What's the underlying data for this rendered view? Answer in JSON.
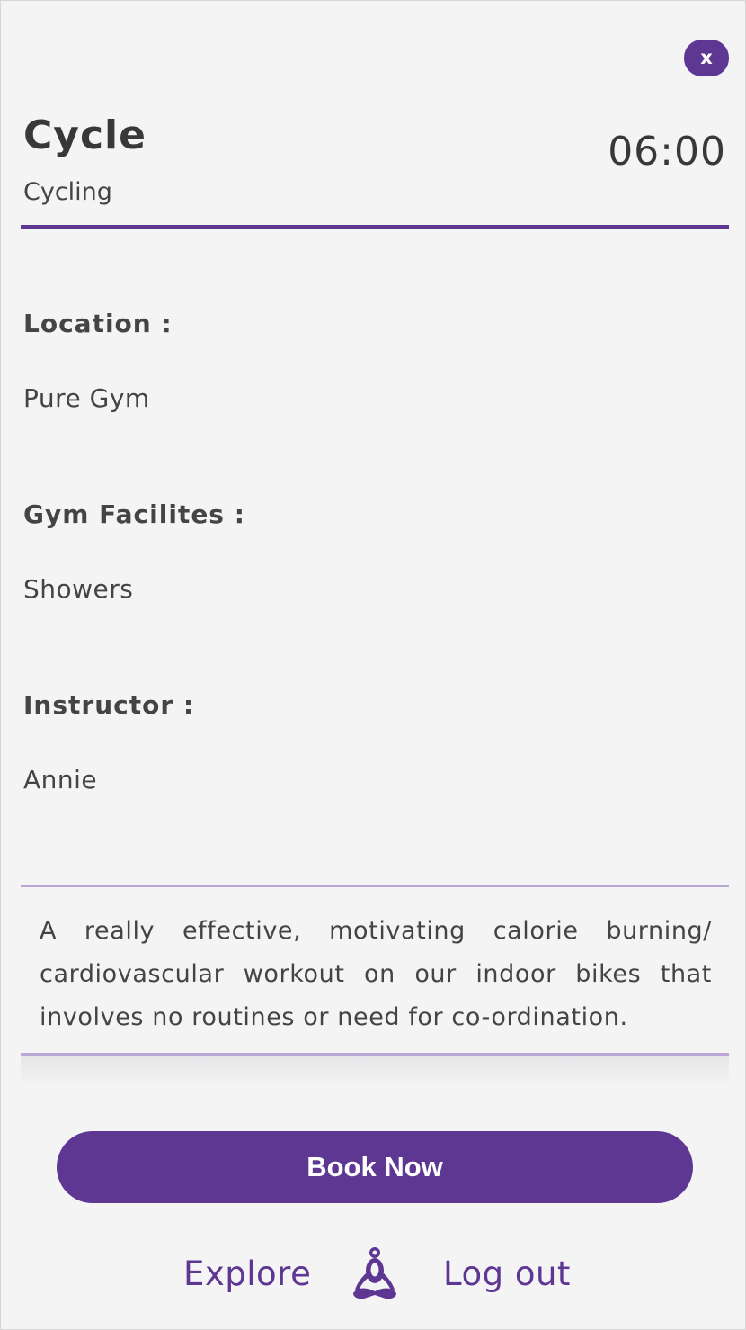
{
  "dialog": {
    "close_label": "x",
    "title": "Cycle",
    "category": "Cycling",
    "time": "06:00"
  },
  "details": {
    "location_label": "Location :",
    "location_value": "Pure Gym",
    "facilities_label": "Gym Facilites :",
    "facilities_value": "Showers",
    "instructor_label": "Instructor :",
    "instructor_value": "Annie"
  },
  "description": "A really effective, motivating calorie burning/ cardiovascular workout on our indoor bikes that involves no routines or need for co-ordination.",
  "actions": {
    "book_label": "Book Now"
  },
  "footer_nav": {
    "explore_label": "Explore",
    "logo_icon": "meditation-figure-icon",
    "logout_label": "Log out"
  },
  "colors": {
    "accent": "#5e3793",
    "divider_light": "#b9a6d3",
    "background": "#f4f4f5",
    "text": "#444444"
  }
}
